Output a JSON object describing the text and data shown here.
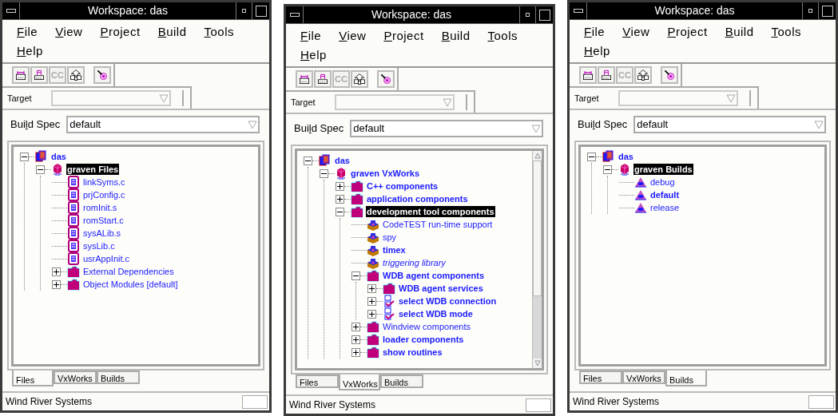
{
  "windows": [
    {
      "title": "Workspace: das",
      "menu": [
        {
          "key": "F",
          "rest": "ile"
        },
        {
          "key": "V",
          "rest": "iew"
        },
        {
          "key": "P",
          "rest": "roject"
        },
        {
          "key": "B",
          "rest": "uild"
        },
        {
          "key": "T",
          "rest": "ools"
        },
        {
          "key": "H",
          "rest": "elp"
        }
      ],
      "toolbar": [
        {
          "kind": "build-all",
          "disabled": false
        },
        {
          "kind": "build-file",
          "disabled": false
        },
        {
          "kind": "text",
          "text": "CC",
          "disabled": true
        },
        {
          "kind": "dependencies",
          "disabled": false
        },
        {
          "kind": "debug",
          "disabled": false
        }
      ],
      "target": {
        "label": "Target",
        "disabled": true
      },
      "build_spec": {
        "label": {
          "before": "Bui",
          "key": "l",
          "after": "d Spec"
        },
        "value": "default"
      },
      "scrollbar": false,
      "tree": [
        {
          "kind": "project",
          "label": "das",
          "bold": true,
          "selected": false,
          "expanded": true,
          "children": [
            {
              "kind": "component-set",
              "label": "graven Files",
              "bold": true,
              "selected": true,
              "expanded": true,
              "children": [
                {
                  "kind": "file",
                  "label": "linkSyms.c",
                  "bold": false,
                  "selected": false
                },
                {
                  "kind": "file",
                  "label": "prjConfig.c",
                  "bold": false,
                  "selected": false
                },
                {
                  "kind": "file",
                  "label": "romInit.s",
                  "bold": false,
                  "selected": false
                },
                {
                  "kind": "file",
                  "label": "romStart.c",
                  "bold": false,
                  "selected": false
                },
                {
                  "kind": "file",
                  "label": "sysALib.s",
                  "bold": false,
                  "selected": false
                },
                {
                  "kind": "file",
                  "label": "sysLib.c",
                  "bold": false,
                  "selected": false
                },
                {
                  "kind": "file",
                  "label": "usrAppInit.c",
                  "bold": false,
                  "selected": false
                },
                {
                  "kind": "folder",
                  "label": "External Dependencies",
                  "bold": false,
                  "selected": false,
                  "expanded": false
                },
                {
                  "kind": "folder",
                  "label": "Object Modules [default]",
                  "bold": false,
                  "selected": false,
                  "expanded": false
                }
              ]
            }
          ]
        }
      ],
      "tabs": [
        {
          "label": "Files",
          "selected": true
        },
        {
          "label": "VxWorks",
          "selected": false
        },
        {
          "label": "Builds",
          "selected": false
        }
      ],
      "status_bar": "Wind River Systems"
    },
    {
      "title": "Workspace: das",
      "menu": [
        {
          "key": "F",
          "rest": "ile"
        },
        {
          "key": "V",
          "rest": "iew"
        },
        {
          "key": "P",
          "rest": "roject"
        },
        {
          "key": "B",
          "rest": "uild"
        },
        {
          "key": "T",
          "rest": "ools"
        },
        {
          "key": "H",
          "rest": "elp"
        }
      ],
      "toolbar": [
        {
          "kind": "build-all",
          "disabled": false
        },
        {
          "kind": "build-file",
          "disabled": false
        },
        {
          "kind": "text",
          "text": "CC",
          "disabled": true
        },
        {
          "kind": "dependencies",
          "disabled": false
        },
        {
          "kind": "debug",
          "disabled": false
        }
      ],
      "target": {
        "label": "Target",
        "disabled": true
      },
      "build_spec": {
        "label": {
          "before": "Bui",
          "key": "l",
          "after": "d Spec"
        },
        "value": "default"
      },
      "scrollbar": true,
      "tree": [
        {
          "kind": "project",
          "label": "das",
          "bold": true,
          "selected": false,
          "expanded": true,
          "children": [
            {
              "kind": "component-set",
              "label": "graven VxWorks",
              "bold": true,
              "selected": false,
              "expanded": true,
              "children": [
                {
                  "kind": "folder",
                  "label": "C++ components",
                  "bold": true,
                  "selected": false,
                  "expanded": false
                },
                {
                  "kind": "folder",
                  "label": "application components",
                  "bold": true,
                  "selected": false,
                  "expanded": false
                },
                {
                  "kind": "folder",
                  "label": "development tool components",
                  "bold": true,
                  "selected": true,
                  "expanded": true,
                  "children": [
                    {
                      "kind": "component",
                      "label": "CodeTEST run-time support",
                      "bold": false,
                      "selected": false
                    },
                    {
                      "kind": "component",
                      "label": "spy",
                      "bold": false,
                      "selected": false
                    },
                    {
                      "kind": "component",
                      "label": "timex",
                      "bold": true,
                      "selected": false
                    },
                    {
                      "kind": "component",
                      "label": "triggering library",
                      "bold": false,
                      "italic": true,
                      "selected": false
                    },
                    {
                      "kind": "folder",
                      "label": "WDB agent components",
                      "bold": true,
                      "selected": false,
                      "expanded": true,
                      "children": [
                        {
                          "kind": "folder",
                          "label": "WDB agent services",
                          "bold": true,
                          "selected": false,
                          "expanded": false
                        },
                        {
                          "kind": "selection",
                          "label": "select WDB connection",
                          "bold": true,
                          "selected": false,
                          "expanded": false
                        },
                        {
                          "kind": "selection",
                          "label": "select WDB mode",
                          "bold": true,
                          "selected": false,
                          "expanded": false
                        }
                      ]
                    },
                    {
                      "kind": "folder",
                      "label": "Windview components",
                      "bold": false,
                      "selected": false,
                      "expanded": false
                    },
                    {
                      "kind": "folder",
                      "label": "loader components",
                      "bold": true,
                      "selected": false,
                      "expanded": false
                    },
                    {
                      "kind": "folder",
                      "label": "show routines",
                      "bold": true,
                      "selected": false,
                      "expanded": false
                    }
                  ]
                }
              ]
            }
          ]
        }
      ],
      "tabs": [
        {
          "label": "Files",
          "selected": false
        },
        {
          "label": "VxWorks",
          "selected": true
        },
        {
          "label": "Builds",
          "selected": false
        }
      ],
      "status_bar": "Wind River Systems"
    },
    {
      "title": "Workspace: das",
      "menu": [
        {
          "key": "F",
          "rest": "ile"
        },
        {
          "key": "V",
          "rest": "iew"
        },
        {
          "key": "P",
          "rest": "roject"
        },
        {
          "key": "B",
          "rest": "uild"
        },
        {
          "key": "T",
          "rest": "ools"
        },
        {
          "key": "H",
          "rest": "elp"
        }
      ],
      "toolbar": [
        {
          "kind": "build-all",
          "disabled": false
        },
        {
          "kind": "build-file",
          "disabled": false
        },
        {
          "kind": "text",
          "text": "CC",
          "disabled": true
        },
        {
          "kind": "dependencies",
          "disabled": false
        },
        {
          "kind": "debug",
          "disabled": false
        }
      ],
      "target": {
        "label": "Target",
        "disabled": true
      },
      "build_spec": {
        "label": {
          "before": "Bui",
          "key": "l",
          "after": "d Spec"
        },
        "value": "default"
      },
      "scrollbar": false,
      "tree": [
        {
          "kind": "project",
          "label": "das",
          "bold": true,
          "selected": false,
          "expanded": true,
          "children": [
            {
              "kind": "component-set",
              "label": "graven Builds",
              "bold": true,
              "selected": true,
              "expanded": true,
              "children": [
                {
                  "kind": "build",
                  "label": "debug",
                  "bold": false,
                  "selected": false
                },
                {
                  "kind": "build",
                  "label": "default",
                  "bold": true,
                  "selected": false
                },
                {
                  "kind": "build",
                  "label": "release",
                  "bold": false,
                  "selected": false
                }
              ]
            }
          ]
        }
      ],
      "tabs": [
        {
          "label": "Files",
          "selected": false
        },
        {
          "label": "VxWorks",
          "selected": false
        },
        {
          "label": "Builds",
          "selected": true
        }
      ],
      "status_bar": "Wind River Systems"
    }
  ]
}
